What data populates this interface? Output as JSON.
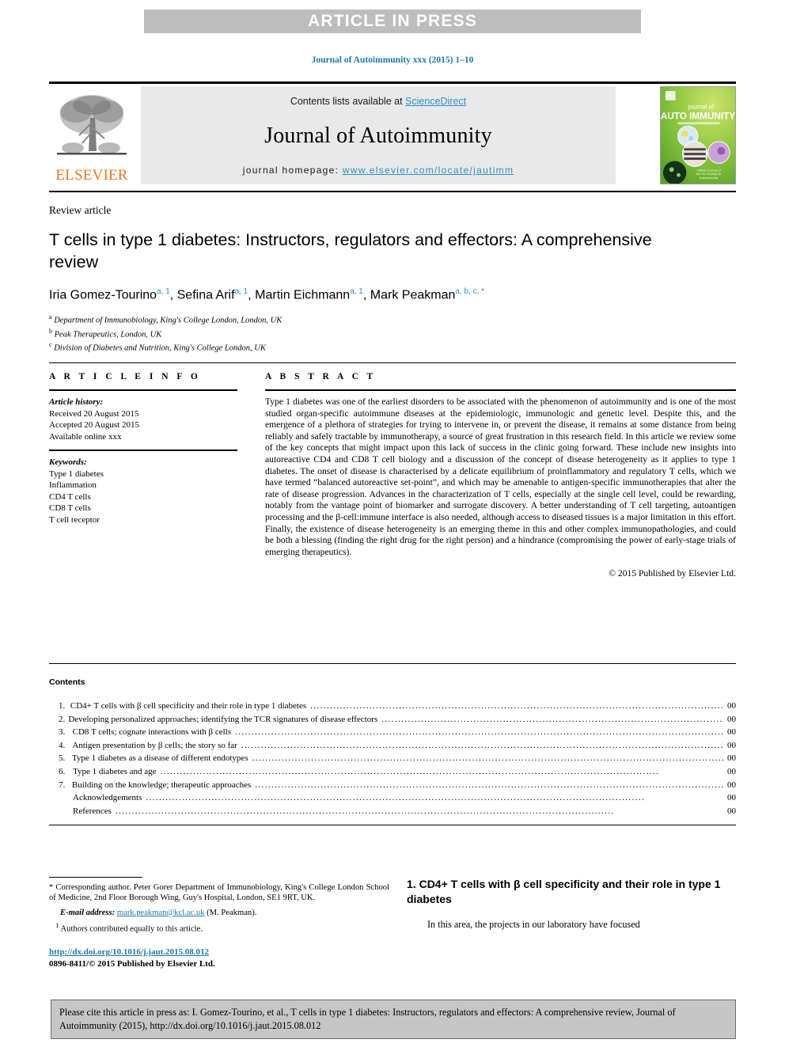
{
  "banner": {
    "text": "ARTICLE IN PRESS"
  },
  "journal_ref": "Journal of Autoimmunity xxx (2015) 1–10",
  "masthead": {
    "contents_prefix": "Contents lists available at ",
    "sciencedirect": "ScienceDirect",
    "journal_title": "Journal of Autoimmunity",
    "homepage_prefix": "journal homepage: ",
    "homepage_url": "www.elsevier.com/locate/jautimm",
    "publisher_wordmark": "ELSEVIER",
    "cover": {
      "line1": "journal of",
      "line2": "AUTO IMMUNITY",
      "accent_color": "#8cc63f"
    }
  },
  "article": {
    "kicker": "Review article",
    "title": "T cells in type 1 diabetes: Instructors, regulators and effectors: A comprehensive review",
    "authors": [
      {
        "name": "Iria Gomez-Tourino",
        "marks": "a, 1"
      },
      {
        "name": "Sefina Arif",
        "marks": "a, 1"
      },
      {
        "name": "Martin Eichmann",
        "marks": "a, 1"
      },
      {
        "name": "Mark Peakman",
        "marks": "a, b, c, *"
      }
    ],
    "affiliations": [
      {
        "mark": "a",
        "text": "Department of Immunobiology, King's College London, London, UK"
      },
      {
        "mark": "b",
        "text": "Peak Therapeutics, London, UK"
      },
      {
        "mark": "c",
        "text": "Division of Diabetes and Nutrition, King's College London, UK"
      }
    ]
  },
  "article_info": {
    "heading": "A R T I C L E   I N F O",
    "history_label": "Article history:",
    "history": [
      "Received 20 August 2015",
      "Accepted 20 August 2015",
      "Available online xxx"
    ],
    "keywords_label": "Keywords:",
    "keywords": [
      "Type 1 diabetes",
      "Inflammation",
      "CD4 T cells",
      "CD8 T cells",
      "T cell receptor"
    ]
  },
  "abstract": {
    "heading": "A B S T R A C T",
    "body": "Type 1 diabetes was one of the earliest disorders to be associated with the phenomenon of autoimmunity and is one of the most studied organ-specific autoimmune diseases at the epidemiologic, immunologic and genetic level. Despite this, and the emergence of a plethora of strategies for trying to intervene in, or prevent the disease, it remains at some distance from being reliably and safely tractable by immunotherapy, a source of great frustration in this research field. In this article we review some of the key concepts that might impact upon this lack of success in the clinic going forward. These include new insights into autoreactive CD4 and CD8 T cell biology and a discussion of the concept of disease heterogeneity as it applies to type 1 diabetes. The onset of disease is characterised by a delicate equilibrium of proinflammatory and regulatory T cells, which we have termed “balanced autoreactive set-point”, and which may be amenable to antigen-specific immunotherapies that alter the rate of disease progression. Advances in the characterization of T cells, especially at the single cell level, could be rewarding, notably from the vantage point of biomarker and surrogate discovery. A better understanding of T cell targeting, autoantigen processing and the β-cell:immune interface is also needed, although access to diseased tissues is a major limitation in this effort. Finally, the existence of disease heterogeneity is an emerging theme in this and other complex immunopathologies, and could be both a blessing (finding the right drug for the right person) and a hindrance (compromising the power of early-stage trials of emerging therapeutics).",
    "copyright": "© 2015 Published by Elsevier Ltd."
  },
  "contents": {
    "title": "Contents",
    "items": [
      {
        "num": "1.",
        "label": "CD4+ T cells with β cell specificity and their role in type 1 diabetes",
        "page": "00"
      },
      {
        "num": "2.",
        "label": "Developing personalized approaches; identifying the TCR signatures of disease effectors",
        "page": "00"
      },
      {
        "num": "3.",
        "label": "CD8 T cells; cognate interactions with β cells",
        "page": "00"
      },
      {
        "num": "4.",
        "label": "Antigen presentation by β cells; the story so far",
        "page": "00"
      },
      {
        "num": "5.",
        "label": "Type 1 diabetes as a disease of different endotypes",
        "page": "00"
      },
      {
        "num": "6.",
        "label": "Type 1 diabetes and age",
        "page": "00"
      },
      {
        "num": "7.",
        "label": "Building on the knowledge; therapeutic approaches",
        "page": "00"
      },
      {
        "num": "",
        "label": "Acknowledgements",
        "page": "00"
      },
      {
        "num": "",
        "label": "References",
        "page": "00"
      }
    ]
  },
  "footnotes": {
    "corresponding": "* Corresponding author. Peter Gorer Department of Immunobiology, King's College London School of Medicine, 2nd Floor Borough Wing, Guy's Hospital, London, SE1 9RT, UK.",
    "email_label": "E-mail address:",
    "email": "mark.peakman@kcl.ac.uk",
    "email_suffix": "(M. Peakman).",
    "equal_contrib_mark": "1",
    "equal_contrib": "Authors contributed equally to this article."
  },
  "footer": {
    "doi": "http://dx.doi.org/10.1016/j.jaut.2015.08.012",
    "issn_line": "0896-8411/© 2015 Published by Elsevier Ltd."
  },
  "body_column": {
    "section_number": "1.",
    "section_title": "CD4+ T cells with β cell specificity and their role in type 1 diabetes",
    "first_paragraph": "In this area, the projects in our laboratory have focused"
  },
  "cite_box": {
    "text": "Please cite this article in press as: I. Gomez-Tourino, et al., T cells in type 1 diabetes: Instructors, regulators and effectors: A comprehensive review, Journal of Autoimmunity (2015), http://dx.doi.org/10.1016/j.jaut.2015.08.012"
  }
}
